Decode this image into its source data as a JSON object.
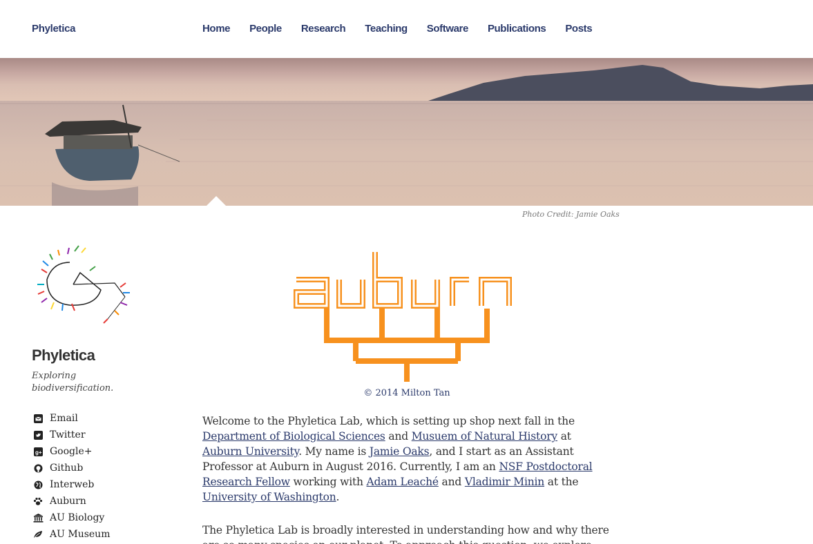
{
  "brand": "Phyletica",
  "nav": [
    "Home",
    "People",
    "Research",
    "Teaching",
    "Software",
    "Publications",
    "Posts"
  ],
  "banner": {
    "credit": "Photo Credit: Jamie Oaks"
  },
  "sidebar": {
    "title": "Phyletica",
    "tagline": "Exploring biodiversification.",
    "links": [
      {
        "label": "Email",
        "icon": "email-icon"
      },
      {
        "label": "Twitter",
        "icon": "twitter-icon"
      },
      {
        "label": "Google+",
        "icon": "google-plus-icon"
      },
      {
        "label": "Github",
        "icon": "github-icon"
      },
      {
        "label": "Interweb",
        "icon": "globe-icon"
      },
      {
        "label": "Auburn",
        "icon": "paw-icon"
      },
      {
        "label": "AU Biology",
        "icon": "institution-icon"
      },
      {
        "label": "AU Museum",
        "icon": "leaf-icon"
      }
    ]
  },
  "main": {
    "logo_caption": "© 2014 Milton Tan",
    "p1": {
      "t1": "Welcome to the Phyletica Lab, which is setting up shop next fall in the ",
      "l1": "Department of Biological Sciences",
      "t2": " and ",
      "l2": "Musuem of Natural History",
      "t3": " at ",
      "l3": "Auburn University",
      "t4": ". My name is ",
      "l4": "Jamie Oaks",
      "t5": ", and I start as an Assistant Professor at Auburn in August 2016. Currently, I am an ",
      "l5": "NSF Postdoctoral Research Fellow",
      "t6": " working with ",
      "l6": "Adam Leaché",
      "t7": " and ",
      "l7": "Vladimir Minin",
      "t8": " at the ",
      "l8": "University of Washington",
      "t9": "."
    },
    "p2": "The Phyletica Lab is broadly interested in understanding how and why there are so many species on our planet. To approach this question, we explore patterns of"
  },
  "colors": {
    "nav": "#2b3a6b",
    "accent_orange": "#f7911e"
  }
}
